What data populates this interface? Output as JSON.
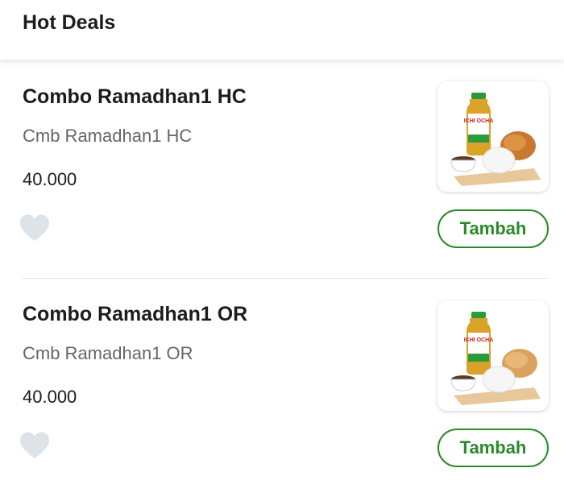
{
  "header": {
    "title": "Hot Deals"
  },
  "items": [
    {
      "title": "Combo Ramadhan1 HC",
      "description": "Cmb Ramadhan1 HC",
      "price": "40.000",
      "add_label": "Tambah",
      "drink_label": "ICHI OCHA",
      "favorite_icon": "heart-icon"
    },
    {
      "title": "Combo Ramadhan1 OR",
      "description": "Cmb Ramadhan1 OR",
      "price": "40.000",
      "add_label": "Tambah",
      "drink_label": "ICHI OCHA",
      "favorite_icon": "heart-icon"
    }
  ],
  "colors": {
    "accent": "#2a8a2a",
    "heart": "#dde3e6",
    "divider": "#e2e2e2"
  }
}
